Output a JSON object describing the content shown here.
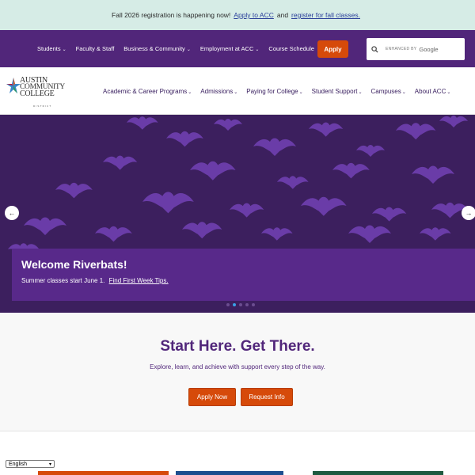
{
  "announcement": {
    "text": "Fall 2026 registration is happening now!",
    "link1": "Apply to ACC",
    "mid": "and",
    "link2": "register for fall classes."
  },
  "utility": {
    "links": [
      "Students",
      "Faculty & Staff",
      "Business & Community",
      "Employment at ACC",
      "Course Schedule"
    ],
    "apply_label": "Apply",
    "search_enhanced": "ENHANCED BY",
    "search_google": "Google"
  },
  "logo": {
    "line1": "AUSTIN",
    "line2": "COMMUNITY",
    "line3": "COLLEGE",
    "district": "DISTRICT"
  },
  "mainnav": {
    "items": [
      "Academic & Career Programs",
      "Admissions",
      "Paying for College",
      "Student Support",
      "Campuses",
      "About ACC"
    ]
  },
  "hero": {
    "title": "Welcome Riverbats!",
    "subtitle": "Summer classes start June 1.",
    "link": "Find First Week Tips.",
    "prev_icon": "←",
    "next_icon": "→"
  },
  "start": {
    "title": "Start Here. Get There.",
    "subtitle": "Explore, learn, and achieve with support every step of the way.",
    "apply_label": "Apply Now",
    "request_label": "Request Info"
  },
  "language": {
    "selected": "English"
  },
  "colors": {
    "purple": "#51267a",
    "orange": "#d64a0a",
    "mint": "#d6ece6"
  }
}
